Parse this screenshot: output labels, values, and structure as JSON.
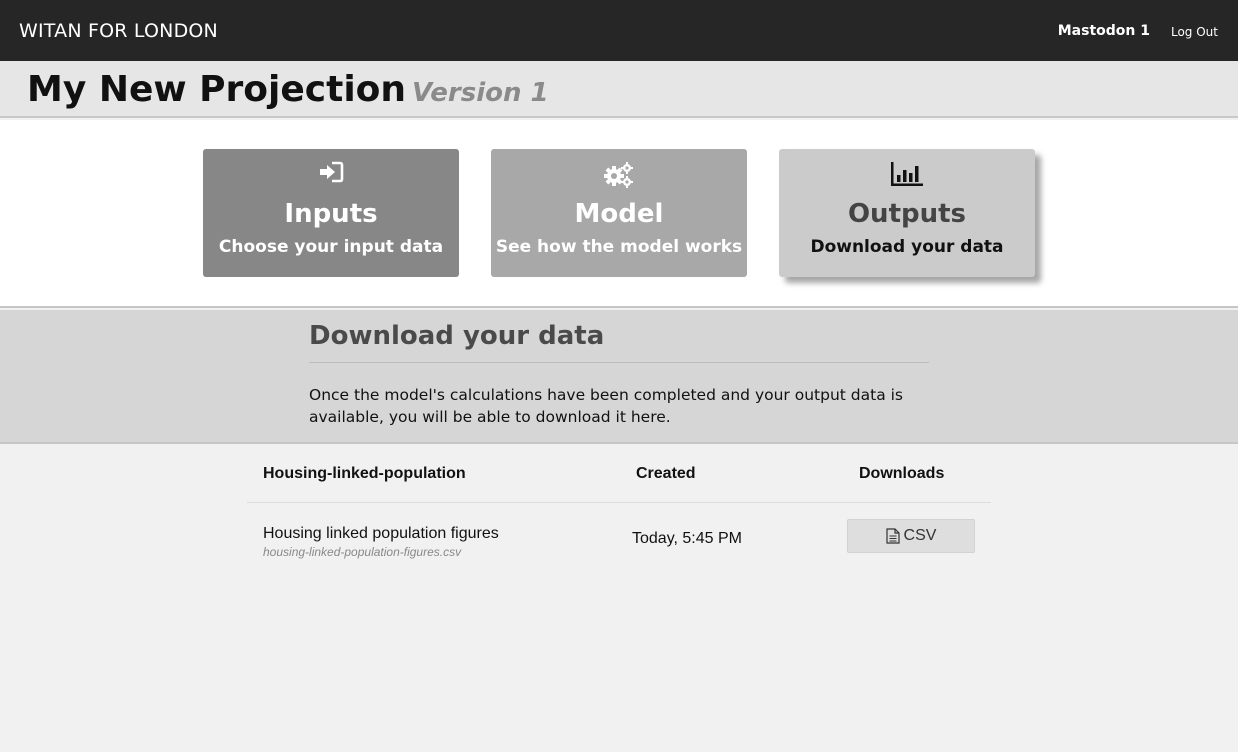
{
  "header": {
    "brand": "WITAN FOR LONDON",
    "user": "Mastodon 1",
    "logout_label": "Log Out"
  },
  "project": {
    "title": "My New Projection",
    "version": "Version 1"
  },
  "cards": [
    {
      "title": "Inputs",
      "subtitle": "Choose your input data",
      "icon": "sign-in-icon",
      "active": false
    },
    {
      "title": "Model",
      "subtitle": "See how the model works",
      "icon": "gears-icon",
      "active": false
    },
    {
      "title": "Outputs",
      "subtitle": "Download your data",
      "icon": "bar-chart-icon",
      "active": true
    }
  ],
  "info": {
    "title": "Download your data",
    "text": "Once the model's calculations have been completed and your output data is available, you will be able to download it here."
  },
  "table": {
    "headers": {
      "name": "Housing-linked-population",
      "created": "Created",
      "downloads": "Downloads"
    },
    "rows": [
      {
        "name": "Housing linked population figures",
        "file": "housing-linked-population-figures.csv",
        "created": "Today, 5:45 PM",
        "download_label": "CSV",
        "download_icon": "file-text-icon"
      }
    ]
  },
  "colors": {
    "topbar": "#262626",
    "card_inputs": "#878787",
    "card_model": "#a8a8a8",
    "card_outputs": "#cbcbcb"
  }
}
